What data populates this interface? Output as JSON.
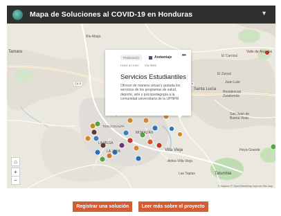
{
  "header": {
    "title": "Mapa de Soluciones al COVID-19 en Honduras",
    "chevron_icon": "chevron-down-icon"
  },
  "map": {
    "places": [
      {
        "id": "rio_abajo",
        "text": "Rio Abajo"
      },
      {
        "id": "tamara",
        "text": "Tamara"
      },
      {
        "id": "el_carrizal",
        "text": "El Carrizal"
      },
      {
        "id": "valle_angeles",
        "text": "Valle de Ángeles"
      },
      {
        "id": "santa_lucia",
        "text": "Santa Lucía"
      },
      {
        "id": "juan_lalo",
        "text": "Juan Lalo"
      },
      {
        "id": "el_zarzal",
        "text": "El Zarzal"
      },
      {
        "id": "residencial",
        "text": "Residencial Zarahemla"
      },
      {
        "id": "san_juan_buena",
        "text": "San Juan de Buena Vista"
      },
      {
        "id": "la_mesa",
        "text": "LA MESA"
      },
      {
        "id": "la_joya",
        "text": "LA JOYA"
      },
      {
        "id": "morazan",
        "text": "MORAZÁN"
      },
      {
        "id": "villa_vieja",
        "text": "Villa Vieja"
      },
      {
        "id": "aldea_villa_vieja",
        "text": "Aldea Villa Vieja"
      },
      {
        "id": "tatumbla",
        "text": "Tatumbla"
      },
      {
        "id": "hoya_grande",
        "text": "Hoya Grande"
      },
      {
        "id": "tegus_partial",
        "text": "TEGUCIGALPA"
      },
      {
        "id": "las_tapias",
        "text": "Las Tapias"
      }
    ],
    "roads": [
      "CA-5",
      "CA-6"
    ],
    "attribution": "© Mapbox © OpenStreetMap Improve this map",
    "zoom_in": "+",
    "zoom_out": "−",
    "home_icon": "home-icon"
  },
  "popup": {
    "badge": "Publicación",
    "category": "Andamiaje",
    "meta_1": "Hace un mes",
    "meta_2": "Vía Web",
    "title": "Servicios Estudiantiles",
    "description": "Ofrecer de manera virtual y gratuita los servicios de los programas de salud, deporte, arte y psicopedagogía a la comunidad universitaria de la UPNFM",
    "menu_icon": "more-icon"
  },
  "buttons": {
    "register": "Registrar una solución",
    "learn_more": "Leer más sobre el proyecto"
  },
  "colors": {
    "header_bg": "#2f3030",
    "accent": "#d35d33"
  }
}
